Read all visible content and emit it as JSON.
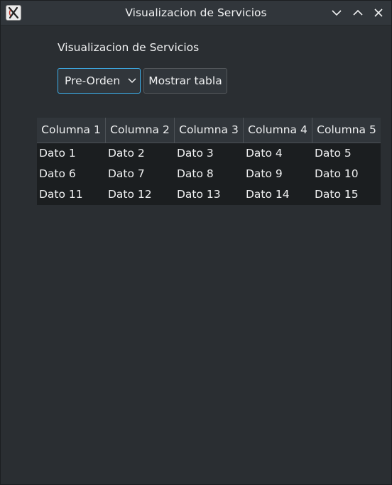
{
  "window": {
    "title": "Visualizacion de Servicios",
    "icon": "app-x-icon",
    "controls": [
      "minimize-icon",
      "maximize-icon",
      "close-icon"
    ]
  },
  "main": {
    "label": "Visualizacion de Servicios",
    "traversal_select": {
      "value": "Pre-Orden",
      "icon": "chevron-down-icon"
    },
    "show_button_label": "Mostrar tabla"
  },
  "table": {
    "columns": [
      "Columna 1",
      "Columna 2",
      "Columna 3",
      "Columna 4",
      "Columna 5"
    ],
    "rows": [
      [
        "Dato 1",
        "Dato 2",
        "Dato 3",
        "Dato 4",
        "Dato 5"
      ],
      [
        "Dato 6",
        "Dato 7",
        "Dato 8",
        "Dato 9",
        "Dato 10"
      ],
      [
        "Dato 11",
        "Dato 12",
        "Dato 13",
        "Dato 14",
        "Dato 15"
      ]
    ]
  },
  "colors": {
    "background": "#2a2e32",
    "titlebar": "#31363b",
    "accent": "#3daee9",
    "table_body": "#1b1e20",
    "text": "#eff0f1"
  }
}
